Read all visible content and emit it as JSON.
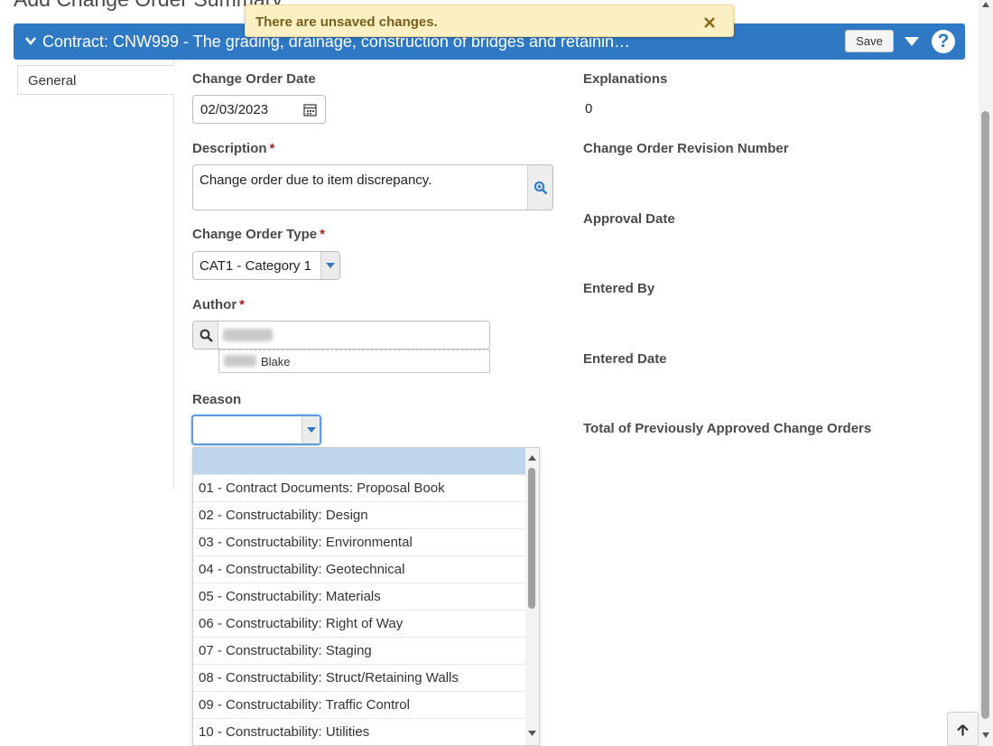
{
  "page": {
    "title": "Add Change Order Summary"
  },
  "notification": {
    "message": "There are unsaved changes."
  },
  "header": {
    "contract_title": "Contract: CNW999 - The grading, drainage, construction of bridges and retainin…",
    "save_label": "Save",
    "help_label": "?"
  },
  "sidebar": {
    "tabs": [
      {
        "label": "General"
      }
    ]
  },
  "form": {
    "change_order_date": {
      "label": "Change Order Date",
      "value": "02/03/2023"
    },
    "description": {
      "label": "Description",
      "required": "*",
      "value": "Change order due to item discrepancy."
    },
    "change_order_type": {
      "label": "Change Order Type",
      "required": "*",
      "value": "CAT1 - Category 1"
    },
    "author": {
      "label": "Author",
      "required": "*",
      "value": "",
      "suggestion_last_name": "Blake"
    },
    "reason": {
      "label": "Reason",
      "value": "",
      "options": [
        "",
        "01 - Contract Documents: Proposal Book",
        "02 - Constructability: Design",
        "03 - Constructability: Environmental",
        "04 - Constructability: Geotechnical",
        "05 - Constructability: Materials",
        "06 - Constructability: Right of Way",
        "07 - Constructability: Staging",
        "08 - Constructability: Struct/Retaining Walls",
        "09 - Constructability: Traffic Control",
        "10 - Constructability: Utilities"
      ]
    }
  },
  "details": {
    "explanations": {
      "label": "Explanations",
      "value": "0"
    },
    "revision_number": {
      "label": "Change Order Revision Number",
      "value": ""
    },
    "approval_date": {
      "label": "Approval Date",
      "value": ""
    },
    "entered_by": {
      "label": "Entered By",
      "value": ""
    },
    "entered_date": {
      "label": "Entered Date",
      "value": ""
    },
    "previous_total": {
      "label": "Total of Previously Approved Change Orders",
      "value": ""
    }
  },
  "colors": {
    "header_blue": "#2f78c4",
    "toast_bg": "#fbefc4",
    "required_red": "#b21d1d",
    "selected_option": "#bfd5ee"
  },
  "icons": [
    "chevron-down-icon",
    "caret-down-icon",
    "help-icon",
    "close-icon",
    "calendar-icon",
    "zoom-in-icon",
    "search-icon",
    "arrow-up-icon"
  ]
}
